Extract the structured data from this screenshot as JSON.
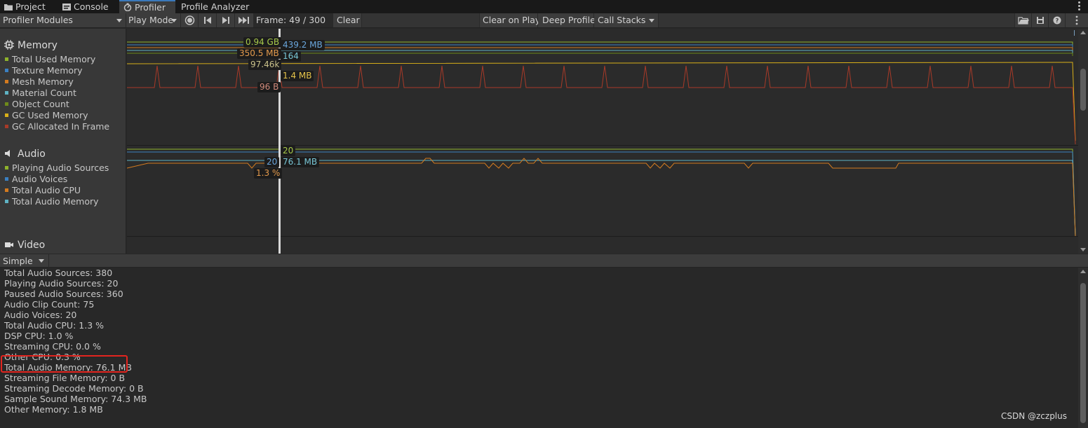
{
  "tabs": [
    {
      "label": "Project",
      "icon": "folder-icon"
    },
    {
      "label": "Console",
      "icon": "console-icon"
    },
    {
      "label": "Profiler",
      "icon": "profiler-icon"
    },
    {
      "label": "Profile Analyzer"
    }
  ],
  "toolbar": {
    "modules_label": "Profiler Modules",
    "play_mode_label": "Play Mode",
    "frame_label": "Frame: 49 / 300",
    "clear_label": "Clear",
    "clear_on_play_label": "Clear on Play",
    "deep_profile_label": "Deep Profile",
    "call_stacks_label": "Call Stacks"
  },
  "memory_module": {
    "title": "Memory",
    "items": [
      {
        "label": "Total Used Memory",
        "color": "#8fb32b"
      },
      {
        "label": "Texture Memory",
        "color": "#3b80c2"
      },
      {
        "label": "Mesh Memory",
        "color": "#d47b1f"
      },
      {
        "label": "Material Count",
        "color": "#5fb3c4"
      },
      {
        "label": "Object Count",
        "color": "#6e8a1a"
      },
      {
        "label": "GC Used Memory",
        "color": "#d9b019"
      },
      {
        "label": "GC Allocated In Frame",
        "color": "#a83a28"
      }
    ],
    "readouts": {
      "total_used": "0.94 GB",
      "texture": "439.2 MB",
      "mesh": "350.5 MB",
      "material": "164",
      "object_count": "97.46k",
      "gc_used": "1.4 MB",
      "gc_alloc": "96 B"
    }
  },
  "audio_module": {
    "title": "Audio",
    "items": [
      {
        "label": "Playing Audio Sources",
        "color": "#8fb32b"
      },
      {
        "label": "Audio Voices",
        "color": "#3b80c2"
      },
      {
        "label": "Total Audio CPU",
        "color": "#d47b1f"
      },
      {
        "label": "Total Audio Memory",
        "color": "#5fb3c4"
      }
    ],
    "readouts": {
      "playing_sources": "20",
      "voices": "20",
      "memory": "76.1 MB",
      "cpu": "1.3 %"
    }
  },
  "video_module": {
    "title": "Video"
  },
  "details": {
    "view_mode": "Simple",
    "lines": [
      "Total Audio Sources: 380",
      "Playing Audio Sources: 20",
      "Paused Audio Sources: 360",
      "Audio Clip Count: 75",
      "Audio Voices: 20",
      "Total Audio CPU: 1.3 %",
      "DSP CPU: 1.0 %",
      "Streaming CPU: 0.0 %",
      "Other CPU: 0.3 %",
      "Total Audio Memory: 76.1 MB",
      "Streaming File Memory: 0 B",
      "Streaming Decode Memory: 0 B",
      "Sample Sound Memory: 74.3 MB",
      "Other Memory: 1.8 MB"
    ],
    "highlighted_line": "Total Audio Memory: 76.1 MB"
  },
  "watermark": "CSDN @zczplus"
}
